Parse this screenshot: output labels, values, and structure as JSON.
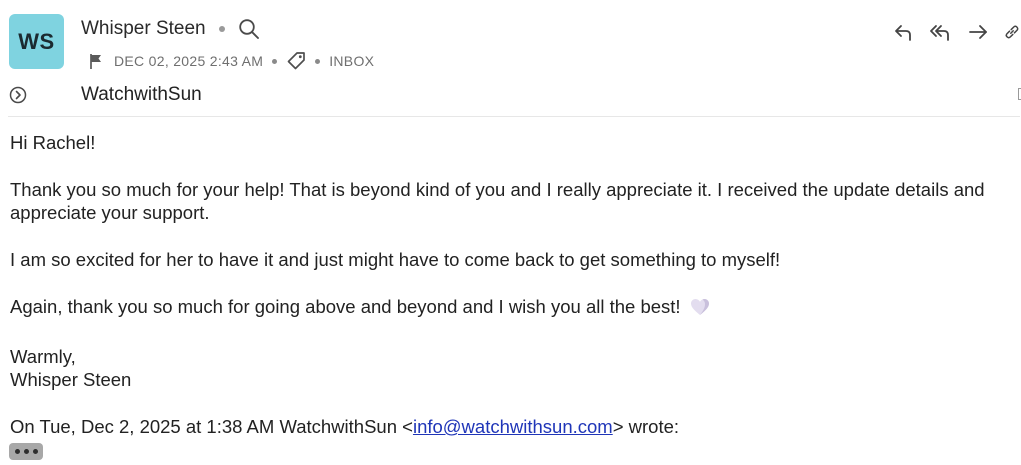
{
  "theme": {
    "avatar_color": "#7fd3e0",
    "link_color": "#1f35b8"
  },
  "message": {
    "avatar_initials": "WS",
    "sender_name": "Whisper Steen",
    "date": "DEC 02, 2025 2:43 AM",
    "folder": "INBOX",
    "recipient": "WatchwithSun"
  },
  "icons": {
    "search": "search-icon",
    "flag": "flag-icon",
    "tag": "tag-icon",
    "expand": "chevron-circle-icon",
    "reply": "reply-icon",
    "reply_all": "reply-all-icon",
    "forward": "forward-icon",
    "link": "link-icon"
  },
  "body": {
    "greeting": "Hi Rachel!",
    "paragraph1": "Thank you so much for your help! That is beyond kind of you and I really appreciate it. I received the update details and appreciate your support.",
    "paragraph2": "I am so excited for her to have it and just might have to come back to get something to myself!",
    "paragraph3": "Again, thank you so much for going above and beyond and I wish you all the best!",
    "closing": "Warmly,",
    "signature": "Whisper Steen",
    "quote_prefix": "On Tue, Dec 2, 2025 at 1:38 AM WatchwithSun <",
    "quote_email": "info@watchwithsun.com",
    "quote_suffix": "> wrote:"
  }
}
